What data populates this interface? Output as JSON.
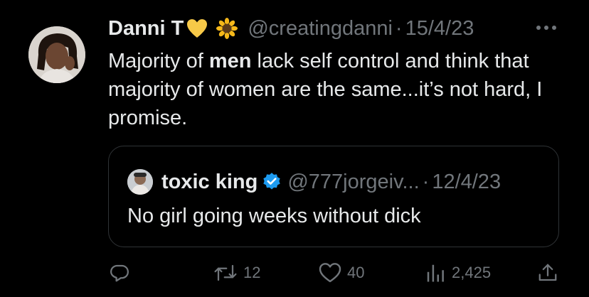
{
  "tweet": {
    "author_name": "Danni T",
    "author_emojis": [
      "yellow-heart-icon",
      "sunflower-icon"
    ],
    "handle": "@creatingdanni",
    "separator": "·",
    "date": "15/4/23",
    "text_before": "Majority of ",
    "text_bold": "men",
    "text_after": " lack self control and think that majority of women are the same...it’s not hard, I promise."
  },
  "quoted": {
    "author_name": "toxic king",
    "verified": true,
    "handle": "@777jorgeiv...",
    "separator": "·",
    "date": "12/4/23",
    "text": "No girl going weeks without dick"
  },
  "actions": {
    "reply_icon": "reply-icon",
    "retweet_count": "12",
    "like_count": "40",
    "views_count": "2,425",
    "share_icon": "share-icon"
  },
  "colors": {
    "background": "#000000",
    "text": "#e7e9ea",
    "muted": "#71767b",
    "verified": "#1d9bf0",
    "border": "#2f3336"
  }
}
